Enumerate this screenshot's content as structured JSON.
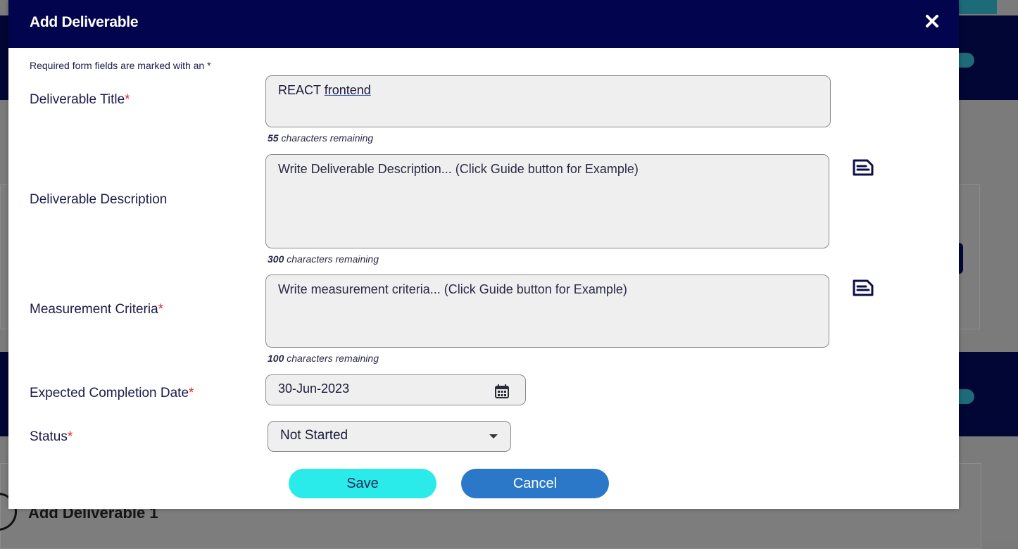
{
  "modal": {
    "title": "Add Deliverable",
    "required_note": "Required form fields are marked with an *"
  },
  "fields": {
    "title": {
      "label": "Deliverable Title",
      "value_part1": "REACT",
      "value_part2": "frontend",
      "remaining_count": "55",
      "remaining_text": "characters remaining"
    },
    "description": {
      "label": "Deliverable Description",
      "placeholder": "Write Deliverable Description... (Click Guide button for Example)",
      "remaining_count": "300",
      "remaining_text": "characters remaining"
    },
    "criteria": {
      "label": "Measurement Criteria",
      "placeholder": "Write measurement criteria... (Click Guide button for Example)",
      "remaining_count": "100",
      "remaining_text": "characters remaining"
    },
    "date": {
      "label": "Expected Completion Date",
      "value": "30-Jun-2023"
    },
    "status": {
      "label": "Status",
      "value": "Not Started"
    }
  },
  "required_marker": "*",
  "buttons": {
    "save": "Save",
    "cancel": "Cancel"
  },
  "background": {
    "bottom_heading": "Add Deliverable 1"
  },
  "colors": {
    "header": "#02044d",
    "save": "#2aebea",
    "cancel": "#2b78c8",
    "required": "#e0262b"
  },
  "icons": {
    "close": "close-icon",
    "guide": "guide-document-icon",
    "calendar": "calendar-icon",
    "dropdown": "chevron-down-icon"
  }
}
